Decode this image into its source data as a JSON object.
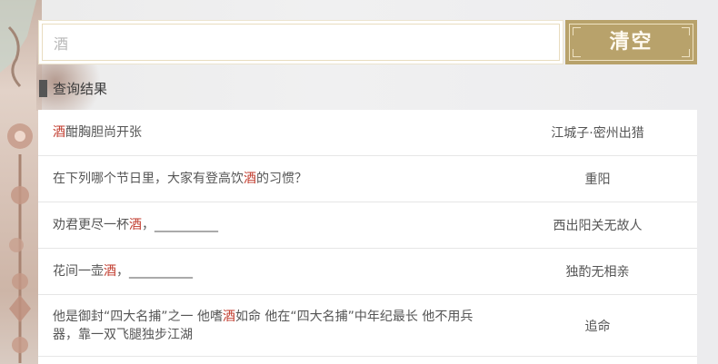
{
  "search": {
    "value": "酒",
    "clear_label": "清空"
  },
  "results_heading": "查询结果",
  "colors": {
    "accent_gold": "#b8a26b",
    "highlight": "#c0392b"
  },
  "results": [
    {
      "q_pre": "",
      "q_hl": "酒",
      "q_post": "酣胸胆尚开张",
      "answer": "江城子·密州出猎"
    },
    {
      "q_pre": "在下列哪个节日里，大家有登高饮",
      "q_hl": "酒",
      "q_post": "的习惯？",
      "answer": "重阳"
    },
    {
      "q_pre": "劝君更尽一杯",
      "q_hl": "酒",
      "q_post": "，__________",
      "answer": "西出阳关无故人"
    },
    {
      "q_pre": "花间一壶",
      "q_hl": "酒",
      "q_post": "，__________",
      "answer": "独酌无相亲"
    },
    {
      "q_pre": "他是御封“四大名捕”之一 他嗜",
      "q_hl": "酒",
      "q_post": "如命 他在“四大名捕”中年纪最长 他不用兵器，靠一双飞腿独步江湖",
      "answer": "追命"
    }
  ]
}
